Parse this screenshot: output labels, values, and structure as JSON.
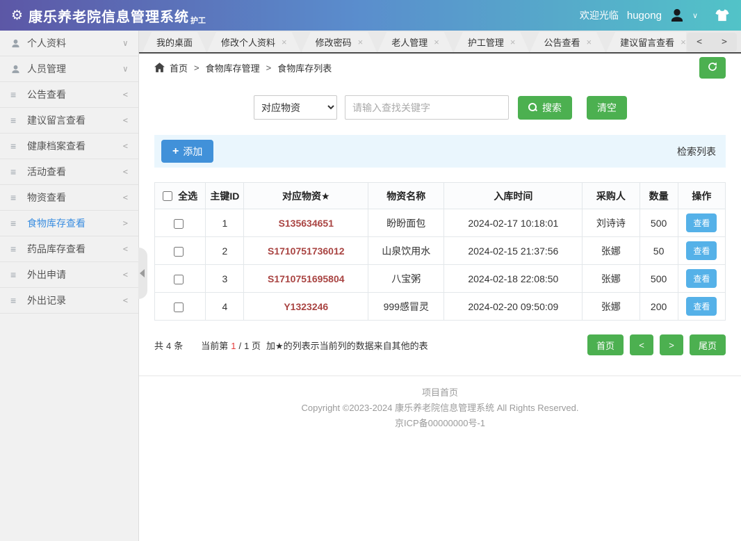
{
  "header": {
    "app_title": "康乐养老院信息管理系统",
    "role_tag": "护工",
    "welcome_text": "欢迎光临",
    "username": "hugong"
  },
  "tabs": {
    "close_glyph": "×",
    "scroll_prev": "<",
    "scroll_next": ">",
    "items": [
      {
        "label": "我的桌面",
        "closable": false
      },
      {
        "label": "修改个人资料",
        "closable": true
      },
      {
        "label": "修改密码",
        "closable": true
      },
      {
        "label": "老人管理",
        "closable": true
      },
      {
        "label": "护工管理",
        "closable": true
      },
      {
        "label": "公告查看",
        "closable": true
      },
      {
        "label": "建议留言查看",
        "closable": true
      }
    ]
  },
  "sidebar": {
    "items": [
      {
        "label": "个人资料",
        "icon": "user-icon",
        "arrow": "∨"
      },
      {
        "label": "人员管理",
        "icon": "user-icon",
        "arrow": "∨"
      },
      {
        "label": "公告查看",
        "icon": "list-icon",
        "arrow": "<"
      },
      {
        "label": "建议留言查看",
        "icon": "list-icon",
        "arrow": "<"
      },
      {
        "label": "健康档案查看",
        "icon": "list-icon",
        "arrow": "<"
      },
      {
        "label": "活动查看",
        "icon": "list-icon",
        "arrow": "<"
      },
      {
        "label": "物资查看",
        "icon": "list-icon",
        "arrow": "<"
      },
      {
        "label": "食物库存查看",
        "icon": "list-icon",
        "arrow": ">",
        "active": true
      },
      {
        "label": "药品库存查看",
        "icon": "list-icon",
        "arrow": "<"
      },
      {
        "label": "外出申请",
        "icon": "list-icon",
        "arrow": "<"
      },
      {
        "label": "外出记录",
        "icon": "list-icon",
        "arrow": "<"
      }
    ]
  },
  "breadcrumb": {
    "home": "首页",
    "separator": ">",
    "section": "食物库存管理",
    "page": "食物库存列表"
  },
  "search": {
    "filter_selected": "对应物资",
    "placeholder": "请输入查找关键字",
    "search_label": "搜索",
    "clear_label": "清空"
  },
  "toolbar": {
    "add_label": "添加",
    "plus_glyph": "+",
    "right_label": "检索列表"
  },
  "table": {
    "columns": [
      "全选",
      "主键ID",
      "对应物资★",
      "物资名称",
      "入库时间",
      "采购人",
      "数量",
      "操作"
    ],
    "rows": [
      {
        "id": "1",
        "code": "S135634651",
        "name": "盼盼面包",
        "time": "2024-02-17 10:18:01",
        "buyer": "刘诗诗",
        "qty": "500",
        "action": "查看"
      },
      {
        "id": "2",
        "code": "S1710751736012",
        "name": "山泉饮用水",
        "time": "2024-02-15 21:37:56",
        "buyer": "张娜",
        "qty": "50",
        "action": "查看"
      },
      {
        "id": "3",
        "code": "S1710751695804",
        "name": "八宝粥",
        "time": "2024-02-18 22:08:50",
        "buyer": "张娜",
        "qty": "500",
        "action": "查看"
      },
      {
        "id": "4",
        "code": "Y1323246",
        "name": "999感冒灵",
        "time": "2024-02-20 09:50:09",
        "buyer": "张娜",
        "qty": "200",
        "action": "查看"
      }
    ]
  },
  "pagination": {
    "total_prefix": "共",
    "total_count": "4",
    "total_unit": "条",
    "current_label": "当前第",
    "current_page": "1",
    "page_separator": "/",
    "total_pages": "1",
    "page_unit": "页",
    "note": "加★的列表示当前列的数据来自其他的表",
    "btn_first": "首页",
    "btn_prev": "<",
    "btn_next": ">",
    "btn_last": "尾页"
  },
  "footer": {
    "line1": "项目首页",
    "line2": "Copyright ©2023-2024 康乐养老院信息管理系统 All Rights Reserved.",
    "line3": "京ICP备00000000号-1"
  },
  "colors": {
    "header_gradient_start": "#5c57a6",
    "header_gradient_mid": "#5a8dcd",
    "header_gradient_end": "#52c3c8",
    "green_button": "#4cb050",
    "blue_button": "#4191d9",
    "view_button_blue": "#55b1e8",
    "active_menu_blue": "#3b8ee0",
    "code_red": "#a94442",
    "page_number_red": "#e43a3a",
    "toolbar_bg": "#eaf6fd"
  }
}
